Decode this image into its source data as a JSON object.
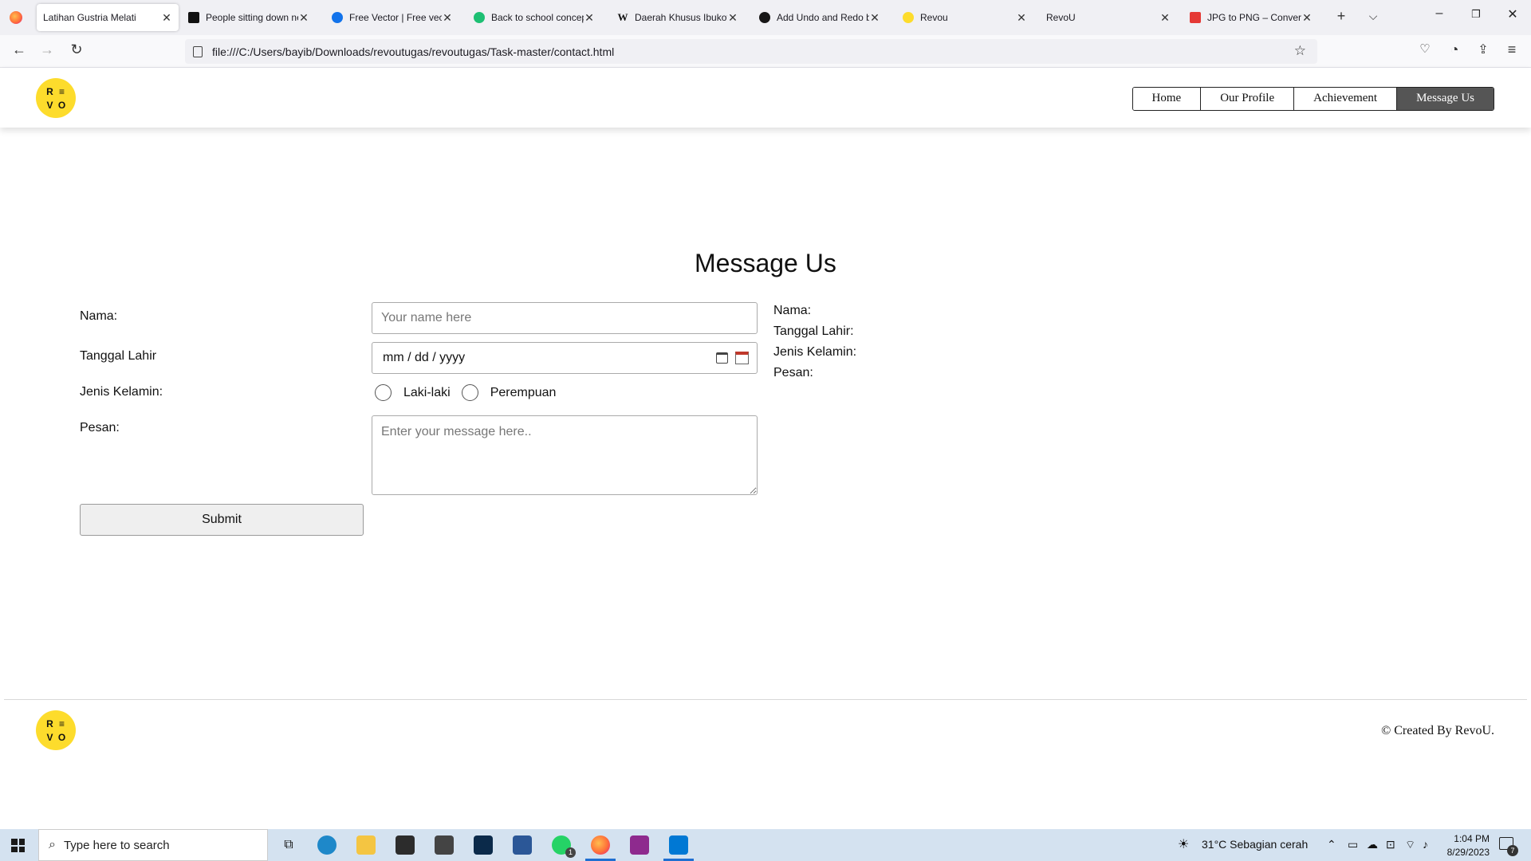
{
  "browser": {
    "tabs": [
      {
        "label": "Latihan Gustria Melati",
        "icon": "page-icon",
        "active": true
      },
      {
        "label": "People sitting down ne",
        "icon": "unsplash-icon",
        "active": false
      },
      {
        "label": "Free Vector | Free vecto",
        "icon": "freepik-icon",
        "active": false
      },
      {
        "label": "Back to school concep",
        "icon": "a-icon",
        "active": false
      },
      {
        "label": "Daerah Khusus Ibukota",
        "icon": "wikipedia-icon",
        "active": false
      },
      {
        "label": "Add Undo and Redo b",
        "icon": "github-icon",
        "active": false
      },
      {
        "label": "Revou",
        "icon": "revou-icon",
        "active": false
      },
      {
        "label": "RevoU",
        "icon": "",
        "active": false
      },
      {
        "label": "JPG to PNG – Convert J",
        "icon": "jpg-png-icon",
        "active": false
      }
    ],
    "url": "file:///C:/Users/bayib/Downloads/revoutugas/revoutugas/Task-master/contact.html",
    "new_tab_symbol": "+",
    "tab_list_symbol": "⌵",
    "close_symbol": "✕"
  },
  "site": {
    "logo_letters": [
      "R",
      "≡",
      "V",
      "O"
    ],
    "nav": [
      "Home",
      "Our Profile",
      "Achievement",
      "Message Us"
    ],
    "title": "Message Us",
    "form": {
      "name_label": "Nama:",
      "name_placeholder": "Your name here",
      "dob_label": "Tanggal Lahir",
      "dob_value": "mm / dd / yyyy",
      "gender_label": "Jenis Kelamin:",
      "gender_options": [
        "Laki-laki",
        "Perempuan"
      ],
      "message_label": "Pesan:",
      "message_placeholder": "Enter your message here..",
      "submit_label": "Submit"
    },
    "summary": [
      "Nama:",
      "Tanggal Lahir:",
      "Jenis Kelamin:",
      "Pesan:"
    ],
    "footer_credit": "© Created By RevoU."
  },
  "taskbar": {
    "search_placeholder": "Type here to search",
    "weather": "31°C  Sebagian cerah",
    "time": "1:04 PM",
    "date": "8/29/2023",
    "whatsapp_badge": "1",
    "notification_count": "7"
  }
}
